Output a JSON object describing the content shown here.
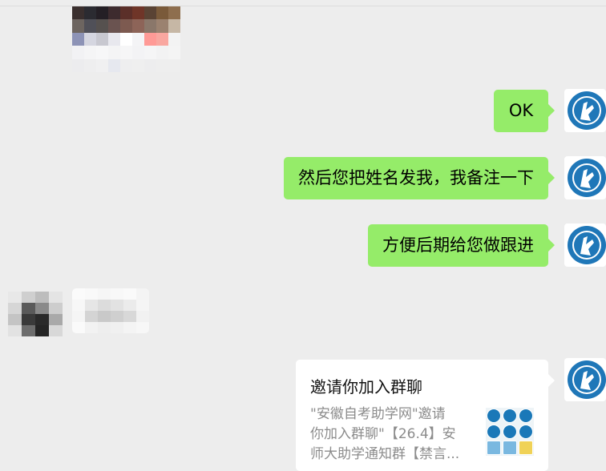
{
  "messages": {
    "ok": "OK",
    "m2": "然后您把姓名发我，我备注一下",
    "m3": "方便后期给您做跟进"
  },
  "invite_card": {
    "title": "邀请你加入群聊",
    "desc_lines": [
      "\"安徽自考助学网\"邀请",
      "你加入群聊\"【26.4】安",
      "师大助学通知群【禁言..."
    ]
  },
  "icons": {
    "avatar": "organization-logo-avatar",
    "group_thumb": "group-avatar-grid-icon"
  },
  "colors": {
    "background": "#ededed",
    "sent_bubble": "#95ec69",
    "card_background": "#ffffff",
    "logo_blue": "#1f77b8"
  }
}
